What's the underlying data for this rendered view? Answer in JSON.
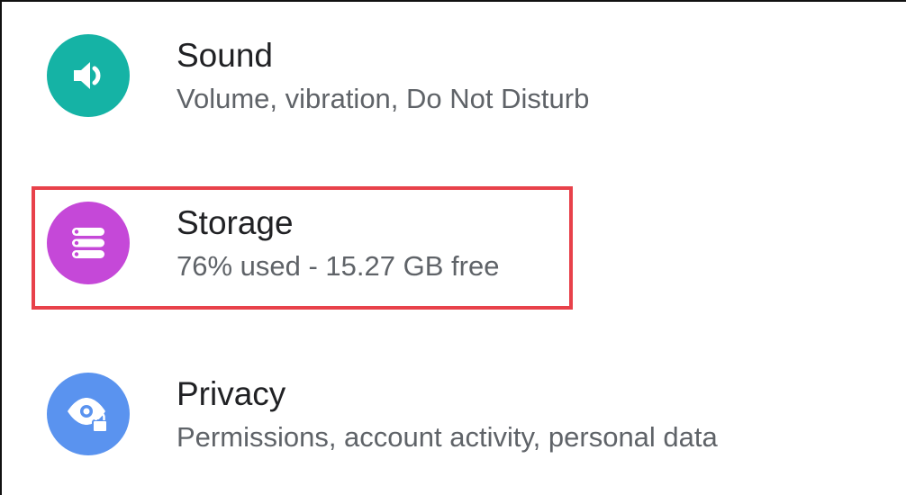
{
  "settings": {
    "items": [
      {
        "title": "Sound",
        "subtitle": "Volume, vibration, Do Not Disturb",
        "icon": "volume-icon",
        "color": "#15b3a5"
      },
      {
        "title": "Storage",
        "subtitle": "76% used - 15.27 GB free",
        "icon": "storage-icon",
        "color": "#c548d8"
      },
      {
        "title": "Privacy",
        "subtitle": "Permissions, account activity, personal data",
        "icon": "privacy-icon",
        "color": "#5a93ef"
      }
    ]
  },
  "highlight": {
    "target": "storage",
    "color": "#e8414a"
  }
}
